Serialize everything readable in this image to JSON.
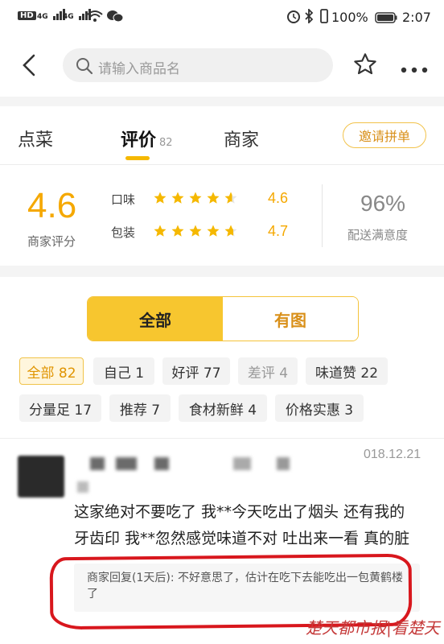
{
  "status_bar": {
    "hd": "HD",
    "net1": "4G",
    "net2": "4G",
    "battery": "100%",
    "time": "2:07"
  },
  "header": {
    "search_placeholder": "请输入商品名"
  },
  "tabs": {
    "order": "点菜",
    "reviews": "评价",
    "reviews_count": "82",
    "merchant": "商家",
    "invite": "邀请拼单"
  },
  "rating": {
    "score": "4.6",
    "score_label": "商家评分",
    "taste_label": "口味",
    "taste_value": "4.6",
    "taste_stars": 4.6,
    "pack_label": "包装",
    "pack_value": "4.7",
    "pack_stars": 4.7,
    "delivery_pct": "96%",
    "delivery_label": "配送满意度"
  },
  "segment": {
    "all": "全部",
    "with_pic": "有图"
  },
  "chips": {
    "row1": [
      "全部 82",
      "自己 1",
      "好评 77",
      "差评 4",
      "味道赞 22"
    ],
    "row2": [
      "分量足 17",
      "推荐 7",
      "食材新鲜 4",
      "价格实惠 3"
    ]
  },
  "review": {
    "date": "018.12.21",
    "line1": "这家绝对不要吃了 我**今天吃出了烟头 还有我的",
    "line2": "牙齿印 我**忽然感觉味道不对 吐出来一看 真的脏",
    "reply": "商家回复(1天后): 不好意思了，估计在吃下去能吃出一包黄鹤楼了"
  },
  "watermark": "楚天都市报|看楚天",
  "colors": {
    "accent": "#f5a800",
    "chip_active": "#e09400",
    "red_annotation": "#d8171d"
  }
}
